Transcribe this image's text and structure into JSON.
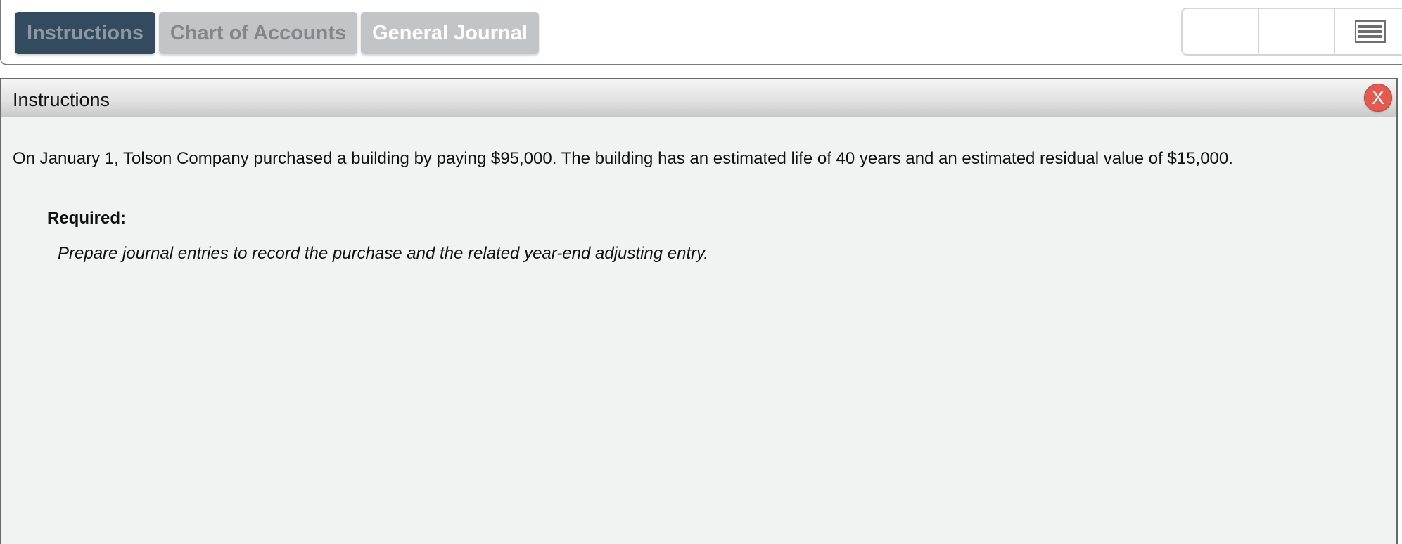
{
  "tabs": [
    {
      "label": "Instructions"
    },
    {
      "label": "Chart of Accounts"
    },
    {
      "label": "General Journal"
    }
  ],
  "toolbar": {
    "menu_icon": "menu-icon"
  },
  "panel": {
    "title": "Instructions",
    "close_label": "X",
    "body": "On January 1, Tolson Company purchased a building by paying $95,000. The building has an estimated life of 40 years and an estimated residual value of $15,000.",
    "required_label": "Required:",
    "required_text": "Prepare journal entries to record the purchase and the related year-end adjusting entry."
  },
  "colors": {
    "active_tab_bg": "#344a5f",
    "inactive_tab_bg": "#c2c5c8",
    "close_button": "#e25b4e",
    "panel_bg": "#f1f3f2"
  }
}
